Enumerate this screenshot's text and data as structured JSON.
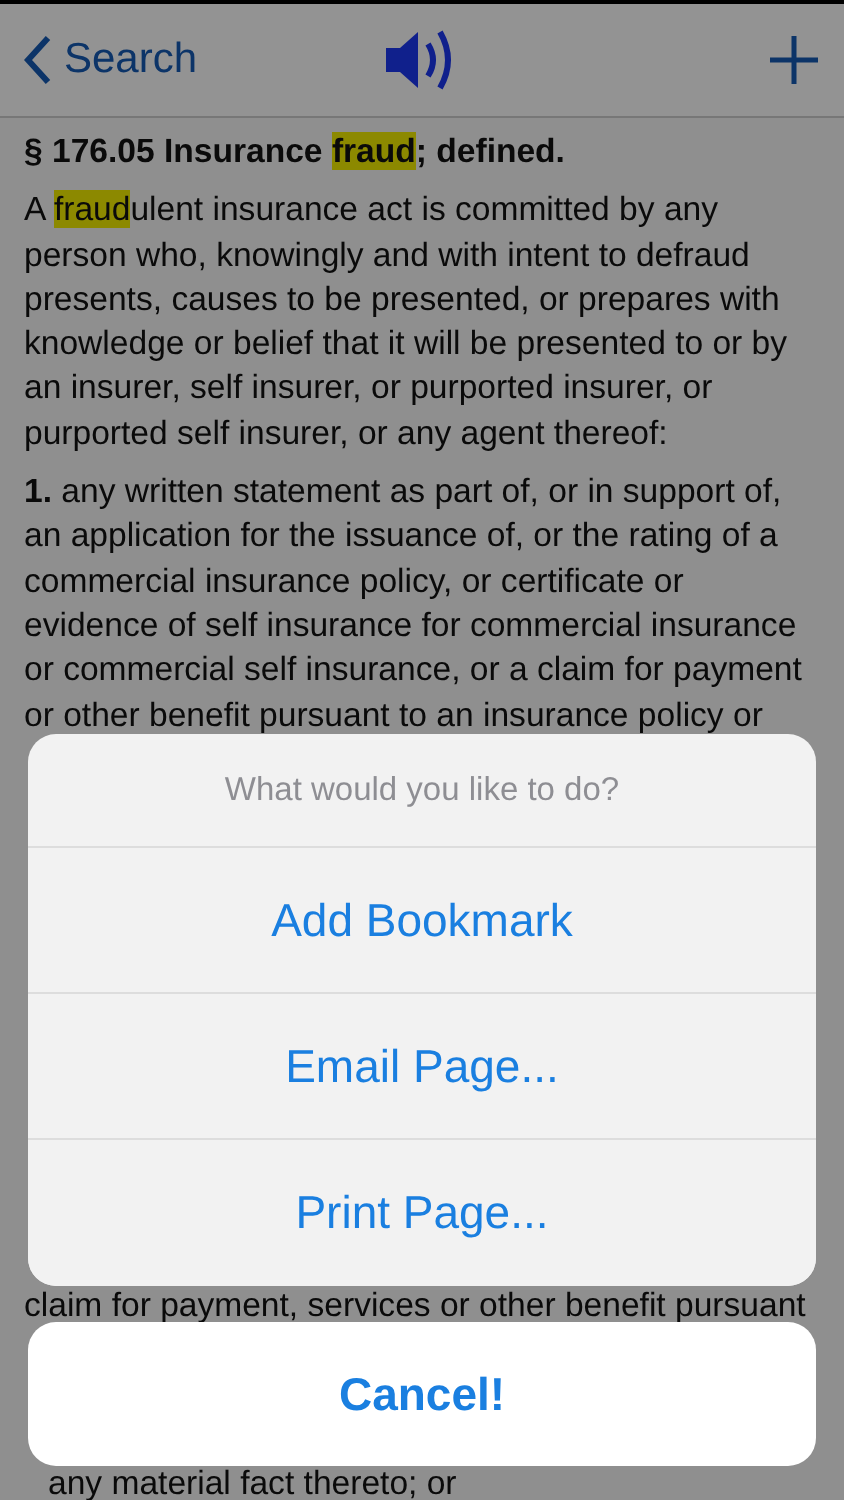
{
  "nav": {
    "back_label": "Search"
  },
  "lines": [
    {
      "kind": "heading",
      "parts": [
        {
          "text": "§ 176.05 Insurance ",
          "highlighted": false
        },
        {
          "text": "fraud",
          "highlighted": true
        },
        {
          "text": "; defined.",
          "highlighted": false
        }
      ]
    },
    {
      "kind": "para",
      "parts": [
        {
          "text": "A ",
          "highlighted": false
        },
        {
          "text": "fraud",
          "highlighted": true
        },
        {
          "text": "ulent insurance act is committed by any",
          "highlighted": false
        }
      ]
    },
    {
      "kind": "text",
      "parts": [
        {
          "text": "person who, knowingly and with intent to defraud",
          "highlighted": false
        }
      ]
    },
    {
      "kind": "text",
      "parts": [
        {
          "text": "presents, causes to be presented, or prepares with",
          "highlighted": false
        }
      ]
    },
    {
      "kind": "text",
      "parts": [
        {
          "text": "knowledge or belief that it will be presented to or by",
          "highlighted": false
        }
      ]
    },
    {
      "kind": "text",
      "parts": [
        {
          "text": "an insurer, self insurer, or purported insurer, or",
          "highlighted": false
        }
      ]
    },
    {
      "kind": "text",
      "parts": [
        {
          "text": "purported self insurer, or any agent thereof:",
          "highlighted": false
        }
      ]
    },
    {
      "kind": "para",
      "parts": [
        {
          "text": "**1.** any written statement as part of, or in support of,",
          "highlighted": false
        }
      ]
    },
    {
      "kind": "text",
      "parts": [
        {
          "text": "an application for the issuance of, or the rating of a",
          "highlighted": false
        }
      ]
    },
    {
      "kind": "text",
      "parts": [
        {
          "text": "commercial insurance policy, or certificate or",
          "highlighted": false
        }
      ]
    },
    {
      "kind": "text",
      "parts": [
        {
          "text": "evidence of self insurance for commercial insurance",
          "highlighted": false
        }
      ]
    },
    {
      "kind": "text",
      "parts": [
        {
          "text": "or commercial self insurance, or a claim for payment",
          "highlighted": false
        }
      ]
    },
    {
      "kind": "text",
      "parts": [
        {
          "text": "or other benefit pursuant to an insurance policy or",
          "highlighted": false
        }
      ]
    },
    {
      "kind": "gap"
    },
    {
      "kind": "gap"
    },
    {
      "kind": "gap"
    },
    {
      "kind": "gap"
    },
    {
      "kind": "gap"
    },
    {
      "kind": "gap"
    },
    {
      "kind": "gap"
    },
    {
      "kind": "gap"
    },
    {
      "kind": "gap"
    },
    {
      "kind": "gap"
    },
    {
      "kind": "gap"
    },
    {
      "kind": "gap"
    },
    {
      "kind": "text",
      "parts": [
        {
          "text": "claim for payment, services or other benefit pursuant",
          "highlighted": false
        }
      ]
    },
    {
      "kind": "gap"
    },
    {
      "kind": "gap"
    },
    {
      "kind": "gap"
    },
    {
      "kind": "indent",
      "parts": [
        {
          "text": "any material fact thereto; or",
          "highlighted": false
        }
      ]
    }
  ],
  "action_sheet": {
    "title": "What would you like to do?",
    "actions": [
      "Add Bookmark",
      "Email Page...",
      "Print Page..."
    ],
    "cancel": "Cancel!"
  }
}
